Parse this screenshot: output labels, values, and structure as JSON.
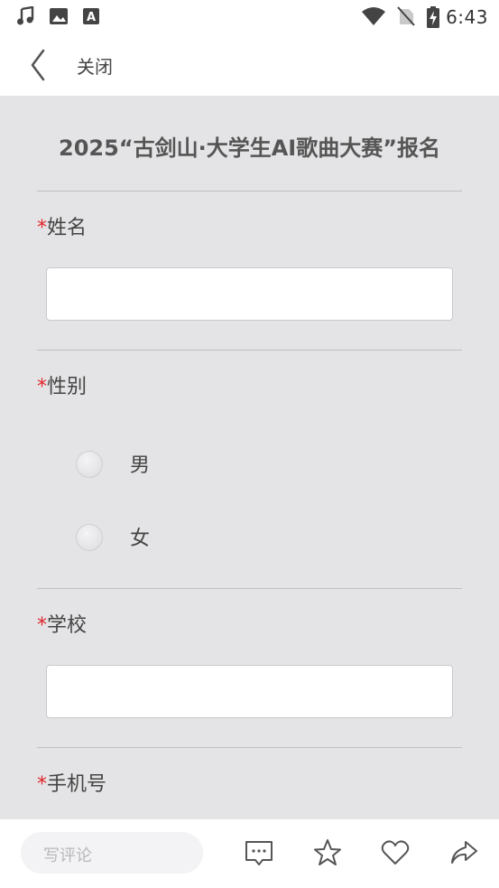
{
  "status_bar": {
    "time": "6:43",
    "icons": [
      "music-note-icon",
      "image-icon",
      "text-a-icon",
      "wifi-icon",
      "no-sim-icon",
      "battery-charging-icon"
    ]
  },
  "nav": {
    "back_icon": "chevron-left-icon",
    "close_label": "关闭"
  },
  "form": {
    "title": "2025“古剑山·大学生AI歌曲大赛”报名",
    "required_mark": "*",
    "fields": {
      "name": {
        "label": "姓名",
        "value": ""
      },
      "gender": {
        "label": "性别",
        "options": [
          "男",
          "女"
        ],
        "selected": null
      },
      "school": {
        "label": "学校",
        "value": ""
      },
      "phone": {
        "label": "手机号"
      }
    }
  },
  "bottom_bar": {
    "comment_placeholder": "写评论",
    "icons": [
      "comment-icon",
      "star-icon",
      "heart-icon",
      "share-icon"
    ]
  },
  "colors": {
    "required": "#e0242a",
    "page_background": "#e4e4e6",
    "text": "#444444"
  }
}
